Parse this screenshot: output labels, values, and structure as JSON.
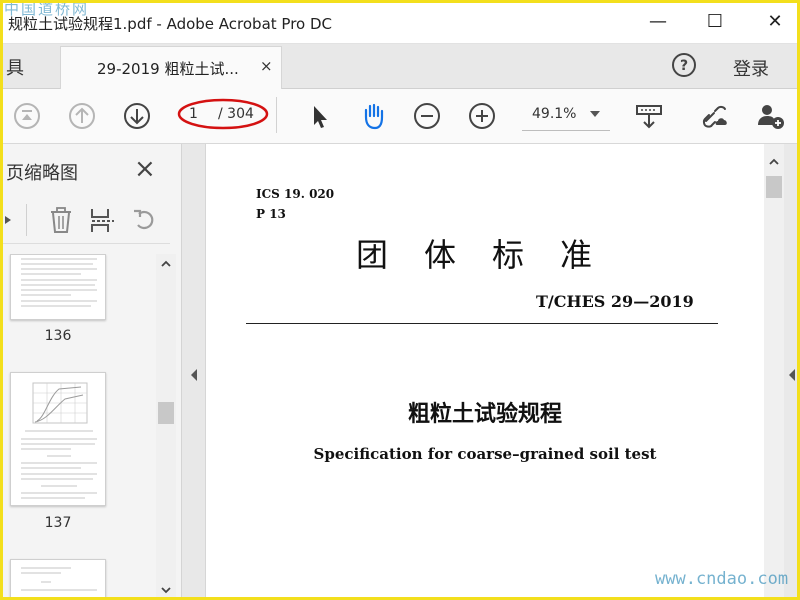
{
  "window": {
    "title": "规粒土试验规程1.pdf - Adobe Acrobat Pro DC",
    "watermark_top": "中国道桥网",
    "controls": [
      "minimize-icon",
      "maximize-icon",
      "close-icon"
    ]
  },
  "tabs": {
    "tools_label": "具",
    "document_tab": "29-2019 粗粒土试...",
    "document_tab_close": "×",
    "login_label": "登录"
  },
  "toolbar": {
    "current_page": "1",
    "total_pages": "/ 304",
    "zoom": "49.1%",
    "icons": [
      "first-page-icon",
      "previous-page-icon",
      "next-page-icon",
      "select-arrow-icon",
      "hand-tool-icon",
      "zoom-out-icon",
      "zoom-in-icon",
      "fit-page-icon",
      "link-cloud-icon",
      "add-user-icon"
    ],
    "accent_color": "#1473e6",
    "highlight_color": "#d41111"
  },
  "sidebar": {
    "title": "页缩略图",
    "close_label": "×",
    "thumbnails": [
      {
        "page_label": "136"
      },
      {
        "page_label": "137"
      }
    ]
  },
  "document": {
    "ics": "ICS 19. 020",
    "p_code": "P 13",
    "standard_type": "团体标准",
    "standard_code": "T/CHES 29—2019",
    "title_cn": "粗粒土试验规程",
    "title_en": "Specification for coarse–grained soil test"
  },
  "watermark_bottom": "www.cndao.com"
}
